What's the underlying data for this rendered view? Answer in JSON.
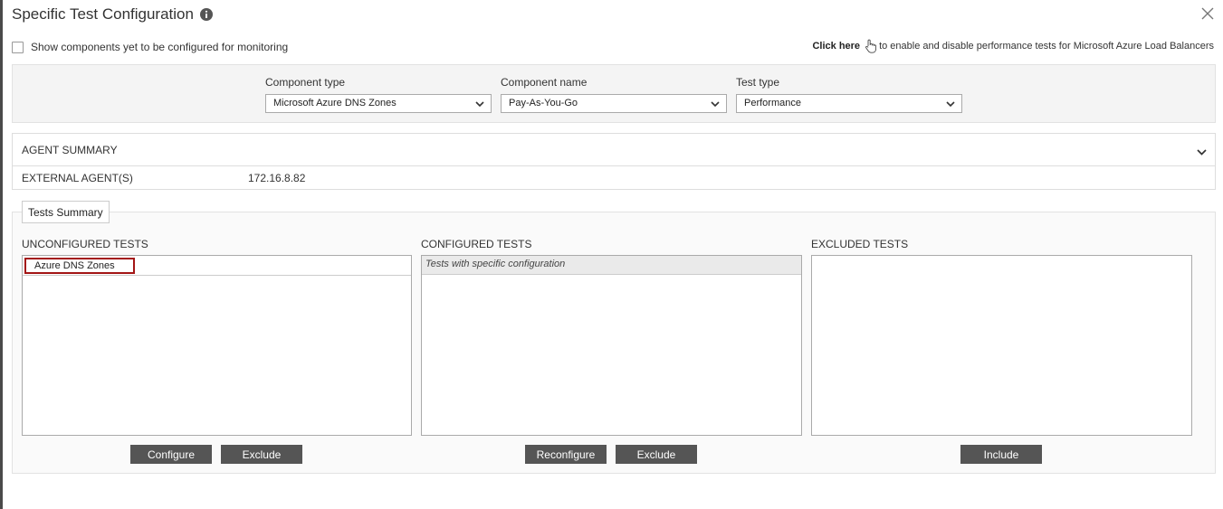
{
  "dialog": {
    "title": "Specific Test Configuration"
  },
  "top": {
    "show_components_label": "Show components yet to be configured for monitoring",
    "show_components_checked": false,
    "click_here": "Click here",
    "click_here_suffix": "to enable and disable performance tests for Microsoft Azure Load Balancers"
  },
  "filters": {
    "component_type": {
      "label": "Component type",
      "value": "Microsoft Azure DNS Zones"
    },
    "component_name": {
      "label": "Component name",
      "value": "Pay-As-You-Go"
    },
    "test_type": {
      "label": "Test type",
      "value": "Performance"
    }
  },
  "agent_summary": {
    "title": "AGENT SUMMARY",
    "external_label": "EXTERNAL AGENT(S)",
    "external_value": "172.16.8.82"
  },
  "tests_summary": {
    "tab_label": "Tests Summary",
    "unconfigured": {
      "label": "UNCONFIGURED TESTS",
      "items": [
        "Azure DNS Zones"
      ]
    },
    "configured": {
      "label": "CONFIGURED TESTS",
      "group_header": "Tests with specific configuration"
    },
    "excluded": {
      "label": "EXCLUDED TESTS"
    },
    "buttons": {
      "configure": "Configure",
      "exclude_unconfigured": "Exclude",
      "reconfigure": "Reconfigure",
      "exclude_configured": "Exclude",
      "include": "Include"
    }
  },
  "colors": {
    "button_bg": "#555555",
    "selected_border": "#a31515",
    "panel_bg": "#f4f4f4"
  }
}
